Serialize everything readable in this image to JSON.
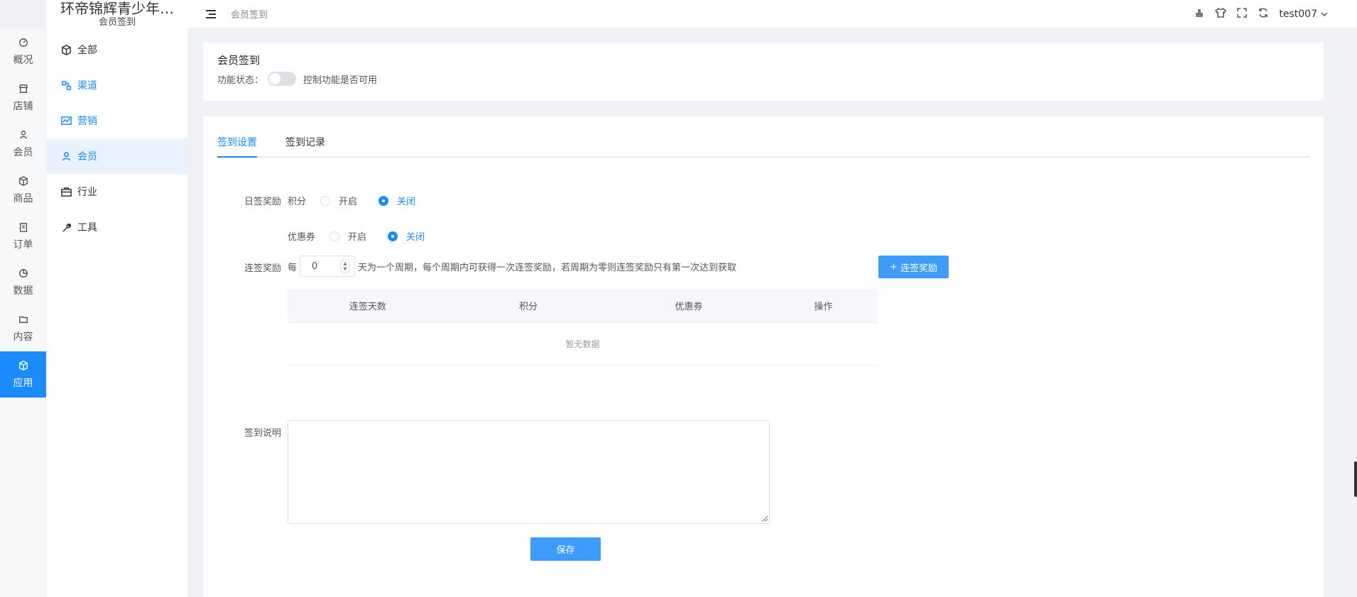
{
  "brand": {
    "title": "环帝锦辉青少年…",
    "subtitle": "会员签到"
  },
  "rail": {
    "items": [
      {
        "label": "概况",
        "icon": "dashboard-icon"
      },
      {
        "label": "店铺",
        "icon": "store-icon"
      },
      {
        "label": "会员",
        "icon": "user-icon"
      },
      {
        "label": "商品",
        "icon": "cube-icon"
      },
      {
        "label": "订单",
        "icon": "clipboard-icon"
      },
      {
        "label": "数据",
        "icon": "pie-chart-icon"
      },
      {
        "label": "内容",
        "icon": "folder-icon"
      },
      {
        "label": "应用",
        "icon": "cube-icon"
      }
    ],
    "active_index": 7
  },
  "sidebar": {
    "items": [
      {
        "label": "全部",
        "icon": "cube-icon"
      },
      {
        "label": "渠道",
        "icon": "channel-icon"
      },
      {
        "label": "营销",
        "icon": "trend-chart-icon"
      },
      {
        "label": "会员",
        "icon": "user-icon"
      },
      {
        "label": "行业",
        "icon": "briefcase-icon"
      },
      {
        "label": "工具",
        "icon": "wrench-icon"
      }
    ],
    "active_index": 3
  },
  "header": {
    "breadcrumb": "会员签到",
    "username": "test007"
  },
  "status_card": {
    "title": "会员签到",
    "status_label": "功能状态：",
    "switch_on": false,
    "switch_hint": "控制功能是否可用"
  },
  "tabs": [
    {
      "label": "签到设置",
      "active": true
    },
    {
      "label": "签到记录",
      "active": false
    }
  ],
  "form": {
    "daily_label": "日签奖励",
    "points_label": "积分",
    "coupon_label": "优惠券",
    "on_label": "开启",
    "off_label": "关闭",
    "points_selected": "关闭",
    "coupon_selected": "关闭",
    "streak_label": "连签奖励",
    "every_label": "每",
    "days_value": "0",
    "streak_desc": "天为一个周期，每个周期内可获得一次连签奖励，若周期为零则连签奖励只有第一次达到获取",
    "add_streak_button": "连签奖励",
    "table_headers": [
      "连签天数",
      "积分",
      "优惠券",
      "操作"
    ],
    "empty_text": "暂无数据",
    "description_label": "签到说明",
    "description_value": "",
    "save_button": "保存"
  },
  "colors": {
    "accent": "#1a8cff",
    "button": "#3e9bff"
  }
}
